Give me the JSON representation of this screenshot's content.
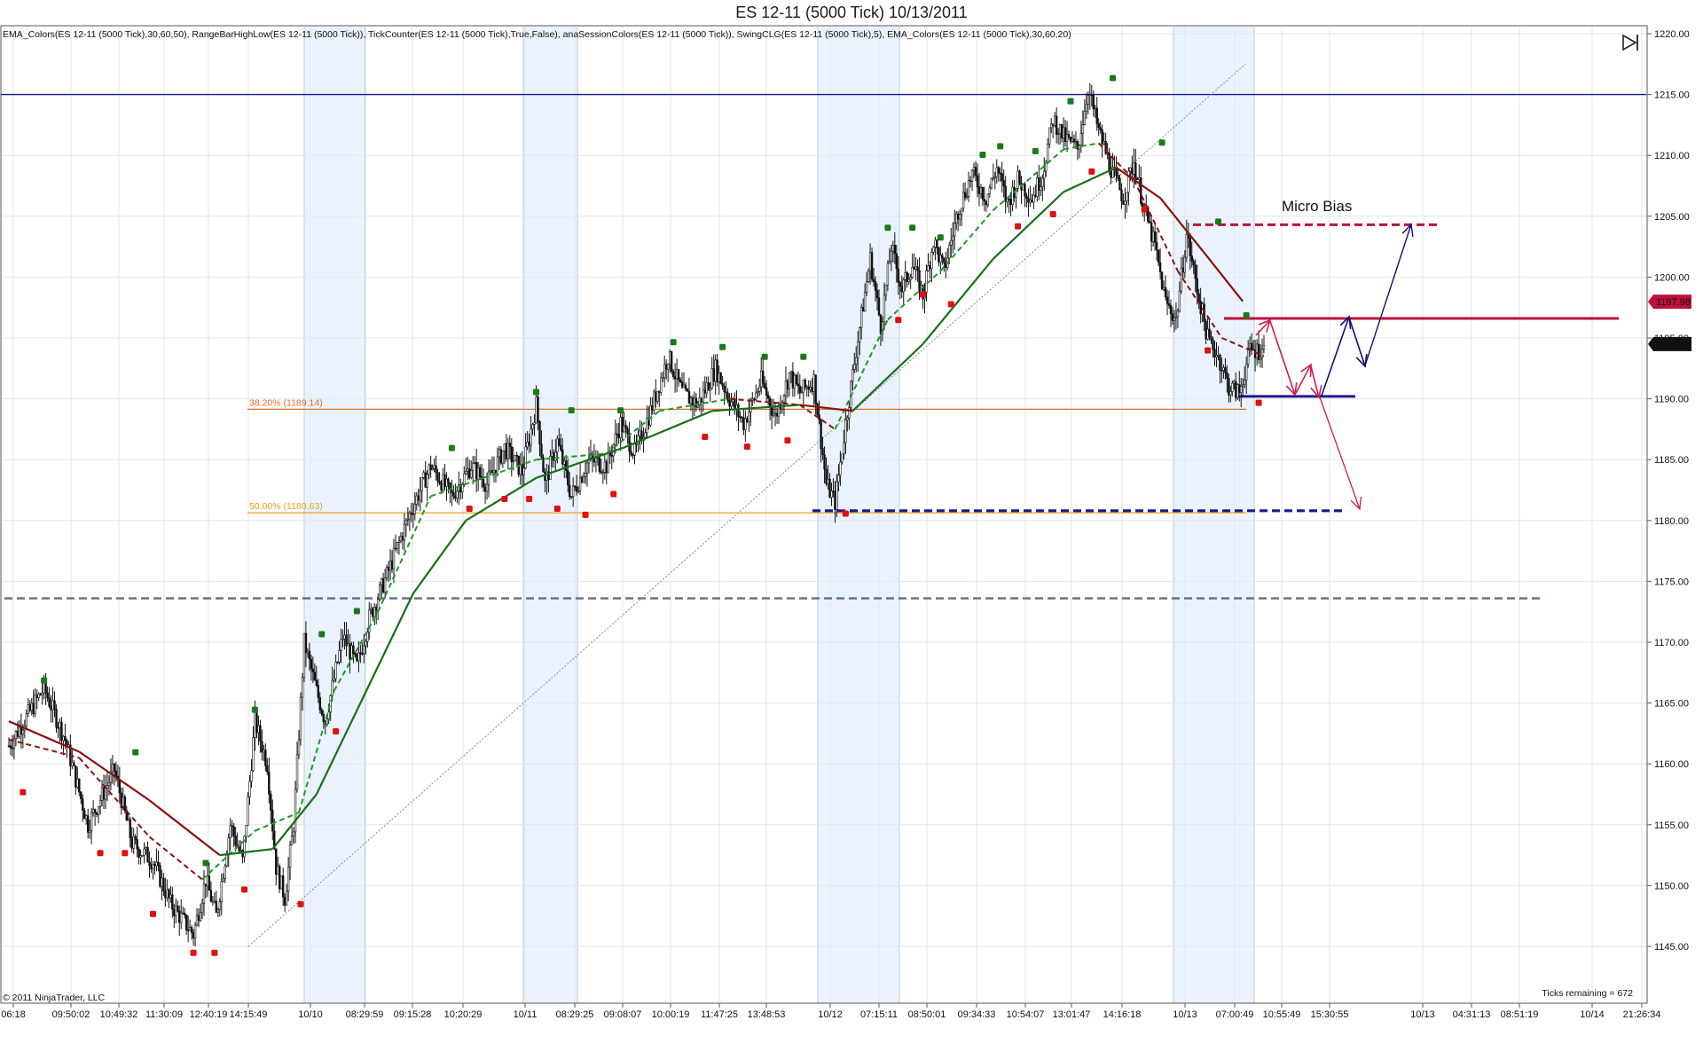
{
  "window": {
    "title": "ES 12-11 (5000 Tick)  10/13/2011"
  },
  "indicators_label": "EMA_Colors(ES 12-11 (5000 Tick),30,60,50), RangeBarHighLow(ES 12-11 (5000 Tick)), TickCounter(ES 12-11 (5000 Tick),True,False), anaSessionColors(ES 12-11 (5000 Tick)), SwingCLG(ES 12-11 (5000 Tick),5), EMA_Colors(ES 12-11 (5000 Tick),30,60,20)",
  "copyright": "© 2011 NinjaTrader, LLC",
  "ticks_remaining": "Ticks remaining = 672",
  "annotation_micro_bias": "Micro Bias",
  "colors": {
    "price_bar": "#111111",
    "ema_fast_up": "#1f9a1f",
    "ema_slow_up": "#1a6e1a",
    "ema_down": "#8b1010",
    "swing_high": "#1a7a1a",
    "swing_low": "#e01010",
    "session_shade": "#eaf3fd",
    "level_blue": "#1a1a8c",
    "level_red": "#c0103a",
    "level_slate": "#5a6f86",
    "fib_382": "#e07030",
    "fib_50": "#e8a020",
    "arrow_red": "#d81b4a",
    "arrow_navy": "#101070"
  },
  "chart_data": {
    "type": "candlestick",
    "instrument": "ES 12-11",
    "bar_type": "5000 Tick",
    "ylim": [
      1143,
      1221
    ],
    "y_ticks": [
      "1220.00",
      "1215.00",
      "1210.00",
      "1205.00",
      "1200.00",
      "1195.00",
      "1190.00",
      "1185.00",
      "1180.00",
      "1175.00",
      "1170.00",
      "1165.00",
      "1160.00",
      "1155.00",
      "1150.00",
      "1145.00"
    ],
    "x_ticks": [
      "06:18",
      "09:50:02",
      "10:49:32",
      "11:30:09",
      "12:40:19",
      "14:15:49",
      "10/10",
      "08:29:59",
      "09:15:28",
      "10:20:29",
      "10/11",
      "08:29:25",
      "09:08:07",
      "10:00:19",
      "11:47:25",
      "13:48:53",
      "10/12",
      "07:15:11",
      "08:50:01",
      "09:34:33",
      "10:54:07",
      "13:01:47",
      "14:16:18",
      "10/13",
      "07:00:49",
      "10:55:49",
      "15:30:55",
      "10/13",
      "04:31:13",
      "08:51:19",
      "10/14",
      "21:26:34"
    ],
    "price_badges": [
      {
        "label": "1197.98",
        "value": 1197.98,
        "color": "#c0103a"
      },
      {
        "label": "1194.50",
        "value": 1194.5,
        "color": "#111111"
      }
    ],
    "fib_levels": [
      {
        "label": "38.20% (1189.14)",
        "value": 1189.14
      },
      {
        "label": "50.00% (1180.63)",
        "value": 1180.63
      }
    ],
    "horizontal_levels": [
      {
        "value": 1215.0,
        "style": "solid",
        "color": "#1a1a8c"
      },
      {
        "value": 1204.3,
        "style": "dashed",
        "color": "#c0103a"
      },
      {
        "value": 1196.6,
        "style": "solid",
        "color": "#c0103a"
      },
      {
        "value": 1190.2,
        "style": "solid",
        "color": "#1a1a8c"
      },
      {
        "value": 1180.8,
        "style": "dashed",
        "color": "#1a1a8c"
      },
      {
        "value": 1173.6,
        "style": "dashed",
        "color": "#5a6f86"
      }
    ],
    "price_path": [
      {
        "x": 0,
        "y": 1161.5
      },
      {
        "x": 20,
        "y": 1166.2
      },
      {
        "x": 32,
        "y": 1162.0
      },
      {
        "x": 45,
        "y": 1155.0
      },
      {
        "x": 60,
        "y": 1159.5
      },
      {
        "x": 70,
        "y": 1153.5
      },
      {
        "x": 82,
        "y": 1152.0
      },
      {
        "x": 92,
        "y": 1148.5
      },
      {
        "x": 105,
        "y": 1146.0
      },
      {
        "x": 112,
        "y": 1150.5
      },
      {
        "x": 118,
        "y": 1147.5
      },
      {
        "x": 126,
        "y": 1155.0
      },
      {
        "x": 133,
        "y": 1152.0
      },
      {
        "x": 140,
        "y": 1163.5
      },
      {
        "x": 147,
        "y": 1160.0
      },
      {
        "x": 152,
        "y": 1151.5
      },
      {
        "x": 157,
        "y": 1149.0
      },
      {
        "x": 162,
        "y": 1155.0
      },
      {
        "x": 168,
        "y": 1170.0
      },
      {
        "x": 175,
        "y": 1166.0
      },
      {
        "x": 180,
        "y": 1163.5
      },
      {
        "x": 190,
        "y": 1170.5
      },
      {
        "x": 198,
        "y": 1168.0
      },
      {
        "x": 205,
        "y": 1172.0
      },
      {
        "x": 215,
        "y": 1175.5
      },
      {
        "x": 228,
        "y": 1180.5
      },
      {
        "x": 240,
        "y": 1184.5
      },
      {
        "x": 252,
        "y": 1182.0
      },
      {
        "x": 263,
        "y": 1184.5
      },
      {
        "x": 272,
        "y": 1183.0
      },
      {
        "x": 282,
        "y": 1186.0
      },
      {
        "x": 292,
        "y": 1184.0
      },
      {
        "x": 300,
        "y": 1189.5
      },
      {
        "x": 305,
        "y": 1183.0
      },
      {
        "x": 312,
        "y": 1186.5
      },
      {
        "x": 320,
        "y": 1182.0
      },
      {
        "x": 330,
        "y": 1185.0
      },
      {
        "x": 340,
        "y": 1184.5
      },
      {
        "x": 348,
        "y": 1188.0
      },
      {
        "x": 356,
        "y": 1185.5
      },
      {
        "x": 365,
        "y": 1189.0
      },
      {
        "x": 375,
        "y": 1193.5
      },
      {
        "x": 383,
        "y": 1190.5
      },
      {
        "x": 392,
        "y": 1189.5
      },
      {
        "x": 402,
        "y": 1192.5
      },
      {
        "x": 410,
        "y": 1190.0
      },
      {
        "x": 418,
        "y": 1188.0
      },
      {
        "x": 428,
        "y": 1191.5
      },
      {
        "x": 436,
        "y": 1188.5
      },
      {
        "x": 444,
        "y": 1192.0
      },
      {
        "x": 450,
        "y": 1190.5
      },
      {
        "x": 458,
        "y": 1191.5
      },
      {
        "x": 465,
        "y": 1183.0
      },
      {
        "x": 470,
        "y": 1181.5
      },
      {
        "x": 476,
        "y": 1188.0
      },
      {
        "x": 482,
        "y": 1194.0
      },
      {
        "x": 490,
        "y": 1201.5
      },
      {
        "x": 496,
        "y": 1196.0
      },
      {
        "x": 502,
        "y": 1202.5
      },
      {
        "x": 508,
        "y": 1199.0
      },
      {
        "x": 514,
        "y": 1201.0
      },
      {
        "x": 520,
        "y": 1198.5
      },
      {
        "x": 526,
        "y": 1203.0
      },
      {
        "x": 532,
        "y": 1200.5
      },
      {
        "x": 540,
        "y": 1205.5
      },
      {
        "x": 548,
        "y": 1208.5
      },
      {
        "x": 556,
        "y": 1206.5
      },
      {
        "x": 562,
        "y": 1209.0
      },
      {
        "x": 568,
        "y": 1206.0
      },
      {
        "x": 574,
        "y": 1208.0
      },
      {
        "x": 582,
        "y": 1206.5
      },
      {
        "x": 588,
        "y": 1208.5
      },
      {
        "x": 594,
        "y": 1213.0
      },
      {
        "x": 600,
        "y": 1211.5
      },
      {
        "x": 608,
        "y": 1210.5
      },
      {
        "x": 614,
        "y": 1215.5
      },
      {
        "x": 620,
        "y": 1212.0
      },
      {
        "x": 628,
        "y": 1208.5
      },
      {
        "x": 634,
        "y": 1206.5
      },
      {
        "x": 640,
        "y": 1209.5
      },
      {
        "x": 646,
        "y": 1205.5
      },
      {
        "x": 652,
        "y": 1202.5
      },
      {
        "x": 658,
        "y": 1198.0
      },
      {
        "x": 664,
        "y": 1196.5
      },
      {
        "x": 670,
        "y": 1203.5
      },
      {
        "x": 676,
        "y": 1199.0
      },
      {
        "x": 682,
        "y": 1195.0
      },
      {
        "x": 688,
        "y": 1193.5
      },
      {
        "x": 694,
        "y": 1191.0
      },
      {
        "x": 700,
        "y": 1190.5
      },
      {
        "x": 706,
        "y": 1194.0
      },
      {
        "x": 714,
        "y": 1194.0
      }
    ],
    "ema_fast": [
      {
        "x": 0,
        "y": 1162.0
      },
      {
        "x": 40,
        "y": 1160.5
      },
      {
        "x": 80,
        "y": 1154.0
      },
      {
        "x": 110,
        "y": 1150.5
      },
      {
        "x": 140,
        "y": 1154.5
      },
      {
        "x": 165,
        "y": 1156.0
      },
      {
        "x": 185,
        "y": 1166.0
      },
      {
        "x": 210,
        "y": 1172.5
      },
      {
        "x": 240,
        "y": 1182.0
      },
      {
        "x": 270,
        "y": 1183.5
      },
      {
        "x": 300,
        "y": 1185.0
      },
      {
        "x": 340,
        "y": 1185.5
      },
      {
        "x": 370,
        "y": 1189.0
      },
      {
        "x": 410,
        "y": 1190.0
      },
      {
        "x": 450,
        "y": 1189.5
      },
      {
        "x": 470,
        "y": 1187.5
      },
      {
        "x": 500,
        "y": 1196.5
      },
      {
        "x": 530,
        "y": 1200.5
      },
      {
        "x": 560,
        "y": 1205.5
      },
      {
        "x": 600,
        "y": 1210.5
      },
      {
        "x": 620,
        "y": 1211.0
      },
      {
        "x": 640,
        "y": 1208.0
      },
      {
        "x": 665,
        "y": 1200.5
      },
      {
        "x": 690,
        "y": 1195.0
      },
      {
        "x": 714,
        "y": 1193.5
      }
    ],
    "ema_slow": [
      {
        "x": 0,
        "y": 1163.5
      },
      {
        "x": 40,
        "y": 1161.0
      },
      {
        "x": 80,
        "y": 1157.0
      },
      {
        "x": 120,
        "y": 1152.5
      },
      {
        "x": 150,
        "y": 1153.0
      },
      {
        "x": 175,
        "y": 1157.5
      },
      {
        "x": 200,
        "y": 1165.0
      },
      {
        "x": 230,
        "y": 1174.0
      },
      {
        "x": 260,
        "y": 1180.0
      },
      {
        "x": 300,
        "y": 1183.5
      },
      {
        "x": 350,
        "y": 1186.0
      },
      {
        "x": 400,
        "y": 1189.0
      },
      {
        "x": 450,
        "y": 1189.5
      },
      {
        "x": 480,
        "y": 1189.0
      },
      {
        "x": 520,
        "y": 1194.5
      },
      {
        "x": 560,
        "y": 1201.5
      },
      {
        "x": 600,
        "y": 1207.0
      },
      {
        "x": 630,
        "y": 1209.0
      },
      {
        "x": 655,
        "y": 1206.5
      },
      {
        "x": 680,
        "y": 1202.0
      },
      {
        "x": 702,
        "y": 1198.0
      }
    ],
    "swing_highs": [
      {
        "x": 20,
        "y": 1166.6
      },
      {
        "x": 72,
        "y": 1160.7
      },
      {
        "x": 112,
        "y": 1151.6
      },
      {
        "x": 140,
        "y": 1164.2
      },
      {
        "x": 178,
        "y": 1170.4
      },
      {
        "x": 198,
        "y": 1172.3
      },
      {
        "x": 252,
        "y": 1185.7
      },
      {
        "x": 300,
        "y": 1190.3
      },
      {
        "x": 320,
        "y": 1188.8
      },
      {
        "x": 348,
        "y": 1188.8
      },
      {
        "x": 378,
        "y": 1194.4
      },
      {
        "x": 406,
        "y": 1194.0
      },
      {
        "x": 430,
        "y": 1193.2
      },
      {
        "x": 452,
        "y": 1193.2
      },
      {
        "x": 500,
        "y": 1203.8
      },
      {
        "x": 514,
        "y": 1203.8
      },
      {
        "x": 530,
        "y": 1203.0
      },
      {
        "x": 554,
        "y": 1209.8
      },
      {
        "x": 564,
        "y": 1210.5
      },
      {
        "x": 584,
        "y": 1210.1
      },
      {
        "x": 604,
        "y": 1214.2
      },
      {
        "x": 628,
        "y": 1216.1
      },
      {
        "x": 656,
        "y": 1210.8
      },
      {
        "x": 688,
        "y": 1204.3
      },
      {
        "x": 704,
        "y": 1196.6
      }
    ],
    "swing_lows": [
      {
        "x": 8,
        "y": 1158.0
      },
      {
        "x": 52,
        "y": 1153.0
      },
      {
        "x": 66,
        "y": 1153.0
      },
      {
        "x": 82,
        "y": 1148.0
      },
      {
        "x": 105,
        "y": 1144.8
      },
      {
        "x": 117,
        "y": 1144.8
      },
      {
        "x": 134,
        "y": 1150.0
      },
      {
        "x": 166,
        "y": 1148.8
      },
      {
        "x": 186,
        "y": 1163.0
      },
      {
        "x": 262,
        "y": 1181.3
      },
      {
        "x": 282,
        "y": 1182.1
      },
      {
        "x": 296,
        "y": 1182.1
      },
      {
        "x": 312,
        "y": 1181.3
      },
      {
        "x": 328,
        "y": 1180.8
      },
      {
        "x": 344,
        "y": 1182.5
      },
      {
        "x": 396,
        "y": 1187.2
      },
      {
        "x": 420,
        "y": 1186.4
      },
      {
        "x": 443,
        "y": 1186.9
      },
      {
        "x": 476,
        "y": 1180.9
      },
      {
        "x": 506,
        "y": 1196.8
      },
      {
        "x": 520,
        "y": 1198.9
      },
      {
        "x": 536,
        "y": 1198.1
      },
      {
        "x": 574,
        "y": 1204.5
      },
      {
        "x": 594,
        "y": 1205.5
      },
      {
        "x": 616,
        "y": 1209.0
      },
      {
        "x": 646,
        "y": 1205.9
      },
      {
        "x": 682,
        "y": 1194.3
      },
      {
        "x": 711,
        "y": 1190.0
      }
    ]
  }
}
